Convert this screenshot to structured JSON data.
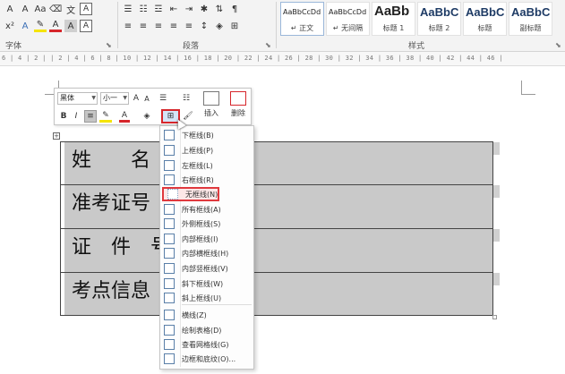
{
  "ribbon": {
    "font_row1": [
      "A",
      "A",
      "Aa",
      "A"
    ],
    "font_row2": [
      "x²",
      "A",
      "A",
      "A",
      "A"
    ],
    "para_row2": [
      "≡",
      "≡",
      "≡",
      "≡",
      "≡"
    ],
    "group_font": "字体",
    "group_paragraph": "段落",
    "group_styles": "样式",
    "styles": [
      {
        "preview": "AaBbCcDd",
        "name": "↵ 正文",
        "size": "small"
      },
      {
        "preview": "AaBbCcDd",
        "name": "↵ 无间隔",
        "size": "small"
      },
      {
        "preview": "AaBb",
        "name": "标题 1",
        "size": "big"
      },
      {
        "preview": "AaBbC",
        "name": "标题 2",
        "size": "mid"
      },
      {
        "preview": "AaBbC",
        "name": "标题",
        "size": "mid"
      },
      {
        "preview": "AaBbC",
        "name": "副标题",
        "size": "mid"
      }
    ]
  },
  "ruler": {
    "text": "6 | 4 | 2 |   | 2 | 4 | 6 | 8 | 10 | 12 | 14 | 16 | 18 | 20 | 22 | 24 | 26 | 28 | 30 | 32 | 34 | 36 | 38 | 40 | 42 | 44 | 46 |"
  },
  "mini_toolbar": {
    "font_name": "黑体",
    "font_size": "小一",
    "bold": "B",
    "italic": "I",
    "insert_label": "插入",
    "delete_label": "删除"
  },
  "table": {
    "handle": "+",
    "rows": [
      "姓　　名",
      "准考证号",
      "证　件　号",
      "考点信息"
    ]
  },
  "border_menu": {
    "items": [
      {
        "label": "下框线(B)",
        "icon": "bottom-border-icon"
      },
      {
        "label": "上框线(P)",
        "icon": "top-border-icon"
      },
      {
        "label": "左框线(L)",
        "icon": "left-border-icon"
      },
      {
        "label": "右框线(R)",
        "icon": "right-border-icon"
      },
      {
        "label": "无框线(N)",
        "icon": "no-border-icon"
      },
      {
        "label": "所有框线(A)",
        "icon": "all-borders-icon"
      },
      {
        "label": "外侧框线(S)",
        "icon": "outside-borders-icon"
      },
      {
        "label": "内部框线(I)",
        "icon": "inside-borders-icon"
      },
      {
        "label": "内部横框线(H)",
        "icon": "inside-horizontal-border-icon"
      },
      {
        "label": "内部竖框线(V)",
        "icon": "inside-vertical-border-icon"
      },
      {
        "label": "斜下框线(W)",
        "icon": "diagonal-down-border-icon"
      },
      {
        "label": "斜上框线(U)",
        "icon": "diagonal-up-border-icon"
      },
      {
        "label": "横线(Z)",
        "icon": "horizontal-line-icon"
      },
      {
        "label": "绘制表格(D)",
        "icon": "draw-table-icon"
      },
      {
        "label": "查看网格线(G)",
        "icon": "view-gridlines-icon"
      },
      {
        "label": "边框和底纹(O)...",
        "icon": "borders-shading-icon"
      }
    ]
  }
}
